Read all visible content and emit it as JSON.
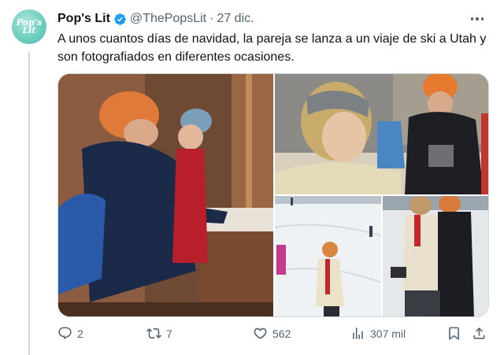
{
  "tweet": {
    "display_name": "Pop's Lit",
    "handle": "@ThePopsLit",
    "separator": "·",
    "date": "27 dic.",
    "text": "A unos cuantos días de navidad, la pareja se lanza a un viaje de ski a Utah y son fotografiados en diferentes ocasiones.",
    "avatar_text": "Pop's Lit"
  },
  "actions": {
    "replies": "2",
    "retweets": "7",
    "likes": "562",
    "views": "307 mil"
  },
  "icons": {
    "verified": "verified-badge-icon",
    "more": "more-options-icon",
    "reply": "reply-icon",
    "retweet": "retweet-icon",
    "like": "heart-icon",
    "views": "views-icon",
    "bookmark": "bookmark-icon",
    "share": "share-icon"
  },
  "colors": {
    "text": "#0f1419",
    "muted": "#536471",
    "verified": "#1d9bf0",
    "border": "#cfd9de"
  }
}
